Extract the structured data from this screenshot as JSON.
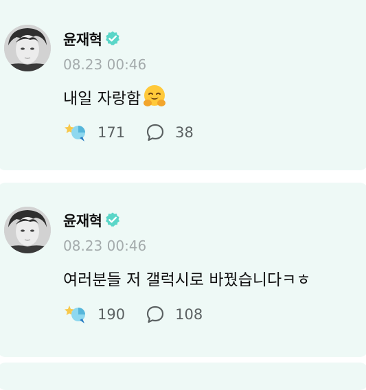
{
  "posts": [
    {
      "author": "윤재혁",
      "timestamp": "08.23 00:46",
      "content": "내일 자랑함",
      "content_emoji": "hugging-face-emoji",
      "likes": "171",
      "comments": "38"
    },
    {
      "author": "윤재혁",
      "timestamp": "08.23 00:46",
      "content": "여러분들 저 갤럭시로 바꿨습니다ㅋㅎ",
      "likes": "190",
      "comments": "108"
    }
  ],
  "colors": {
    "card_background": "#eef9f6",
    "verified_badge": "#5ad6c8",
    "timestamp_text": "#a4abac",
    "count_text": "#5b6162"
  },
  "icons": {
    "verified": "verified-badge-icon",
    "like": "fan-light-icon",
    "comment": "speech-bubble-icon"
  }
}
